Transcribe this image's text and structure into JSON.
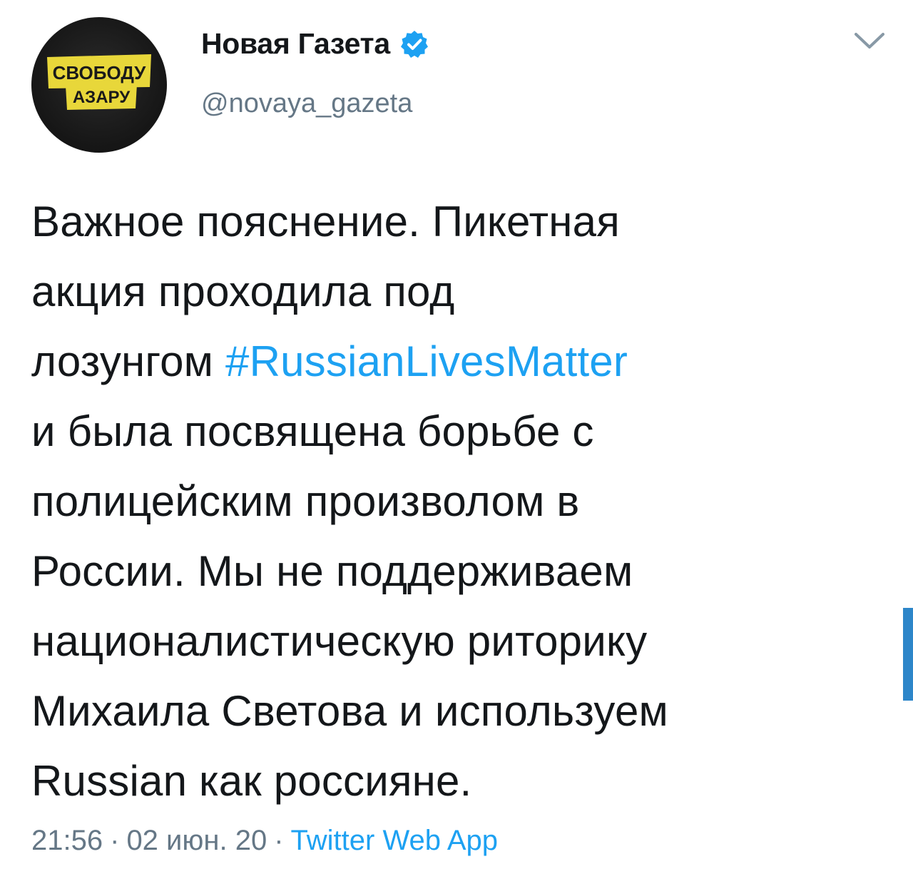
{
  "author": {
    "display_name": "Новая Газета",
    "handle": "@novaya_gazeta",
    "verified": true,
    "avatar": {
      "sign_line1": "СВОБОДУ",
      "sign_line2": "АЗАРУ",
      "sign_color": "#e8d73a",
      "background_color": "#1a1a1a"
    }
  },
  "menu_icon": "chevron-down-icon",
  "tweet": {
    "line1": "Важное пояснение. Пикетная",
    "line2": "акция проходила под",
    "line3_prefix": "лозунгом ",
    "hashtag": "#RussianLivesMatter",
    "line4": "и была посвящена борьбе с",
    "line5": "полицейским произволом в",
    "line6": "России. Мы не поддерживаем",
    "line7": "националистическую риторику",
    "line8": "Михаила Светова и используем",
    "line9": "Russian как россияне."
  },
  "meta": {
    "time": "21:56",
    "separator": "·",
    "date": "02 июн. 20",
    "source": "Twitter Web App"
  },
  "colors": {
    "link": "#1da1f2",
    "secondary_text": "#657786",
    "primary_text": "#14171a",
    "scroll_indicator": "#2d86c9"
  }
}
